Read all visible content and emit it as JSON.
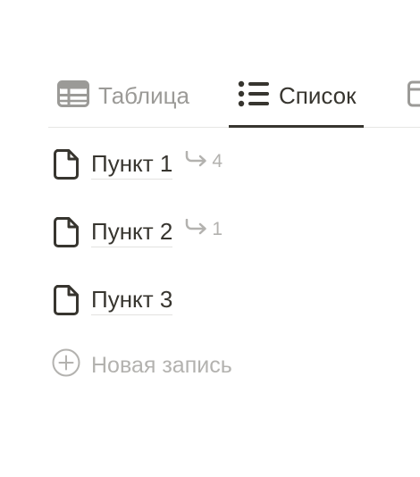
{
  "tabs": {
    "table_label": "Таблица",
    "list_label": "Список",
    "active": "list"
  },
  "items": [
    {
      "title": "Пункт 1",
      "sub_count": "4"
    },
    {
      "title": "Пункт 2",
      "sub_count": "1"
    },
    {
      "title": "Пункт 3"
    }
  ],
  "new_record": {
    "label": "Новая запись"
  },
  "colors": {
    "text": "#37352f",
    "muted": "#9b9a97",
    "faint": "#b3b2af",
    "active_underline": "#37352f",
    "divider": "#e6e6e4"
  },
  "icons": {
    "table": "table-icon",
    "list": "list-icon",
    "document": "page-icon",
    "subitems": "subitem-arrow-icon",
    "add": "plus-circle-icon"
  }
}
